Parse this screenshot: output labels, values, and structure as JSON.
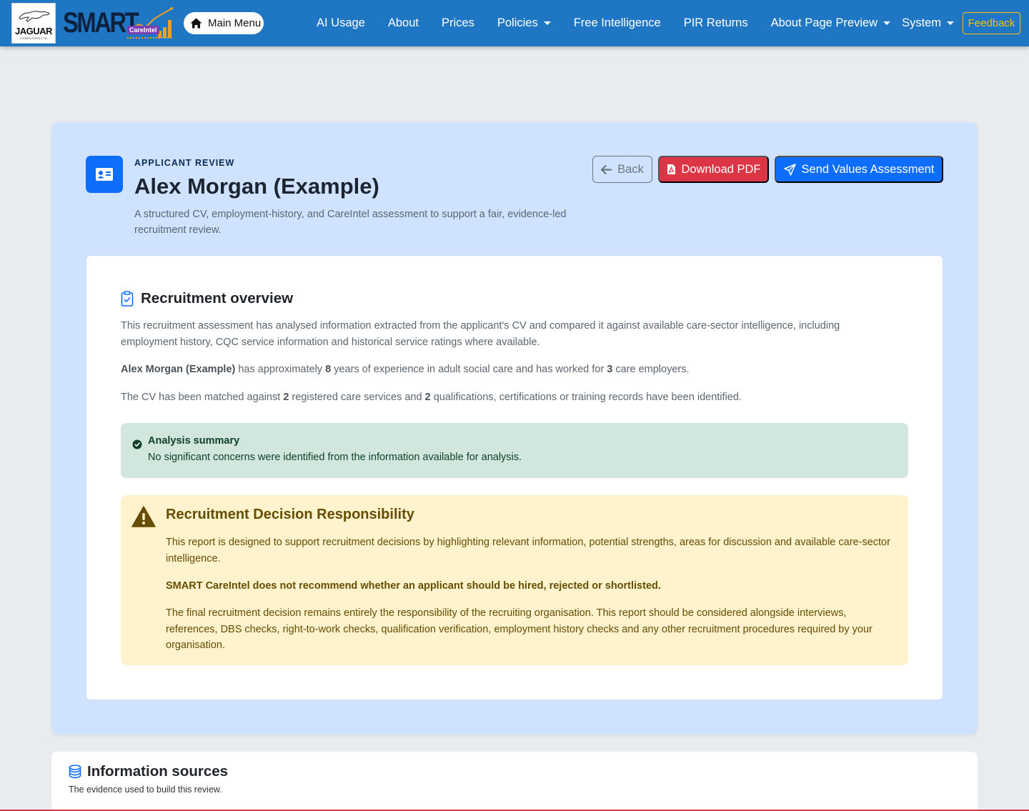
{
  "brand": {
    "jaguar": "JAGUAR",
    "jaguar_sub": "COMPUTERS LTD",
    "smart": "SMART",
    "careintel": "CareIntel"
  },
  "nav": {
    "main_menu": "Main Menu",
    "links": [
      {
        "label": "AI Usage",
        "dropdown": false
      },
      {
        "label": "About",
        "dropdown": false
      },
      {
        "label": "Prices",
        "dropdown": false
      },
      {
        "label": "Policies",
        "dropdown": true
      },
      {
        "label": "Free Intelligence",
        "dropdown": false
      },
      {
        "label": "PIR Returns",
        "dropdown": false
      },
      {
        "label": "About Page Preview",
        "dropdown": true
      },
      {
        "label": "System",
        "dropdown": true
      }
    ],
    "feedback": "Feedback"
  },
  "hero": {
    "eyebrow": "APPLICANT REVIEW",
    "title": "Alex Morgan (Example)",
    "subtitle": "A structured CV, employment-history, and CareIntel assessment to support a fair, evidence-led recruitment review.",
    "buttons": {
      "back": "Back",
      "pdf": "Download PDF",
      "send": "Send Values Assessment"
    }
  },
  "overview": {
    "title": "Recruitment overview",
    "intro": "This recruitment assessment has analysed information extracted from the applicant's CV and compared it against available care-sector intelligence, including employment history, CQC service information and historical service ratings where available.",
    "applicant_name": "Alex Morgan (Example)",
    "experience_pre": " has approximately ",
    "years": "8",
    "experience_mid": " years of experience in adult social care and has worked for ",
    "employers": "3",
    "experience_post": " care employers.",
    "match_pre": "The CV has been matched against ",
    "services": "2",
    "match_mid": " registered care services and ",
    "qualifications": "2",
    "match_post": " qualifications, certifications or training records have been identified."
  },
  "summary": {
    "title": "Analysis summary",
    "body": "No significant concerns were identified from the information available for analysis."
  },
  "responsibility": {
    "title": "Recruitment Decision Responsibility",
    "p1": "This report is designed to support recruitment decisions by highlighting relevant information, potential strengths, areas for discussion and available care-sector intelligence.",
    "p2": "SMART CareIntel does not recommend whether an applicant should be hired, rejected or shortlisted.",
    "p3": "The final recruitment decision remains entirely the responsibility of the recruiting organisation. This report should be considered alongside interviews, references, DBS checks, right-to-work checks, qualification verification, employment history checks and any other recruitment procedures required by your organisation."
  },
  "sources": {
    "title": "Information sources",
    "subtitle": "The evidence used to build this review."
  },
  "colors": {
    "navbar": "#1f76c2",
    "primary": "#0d6efd",
    "danger": "#dc3545",
    "warning": "#ffc107",
    "hero_bg": "#cfe2ff",
    "success_bg": "#d1e7dd",
    "warning_bg": "#fff3cd"
  }
}
